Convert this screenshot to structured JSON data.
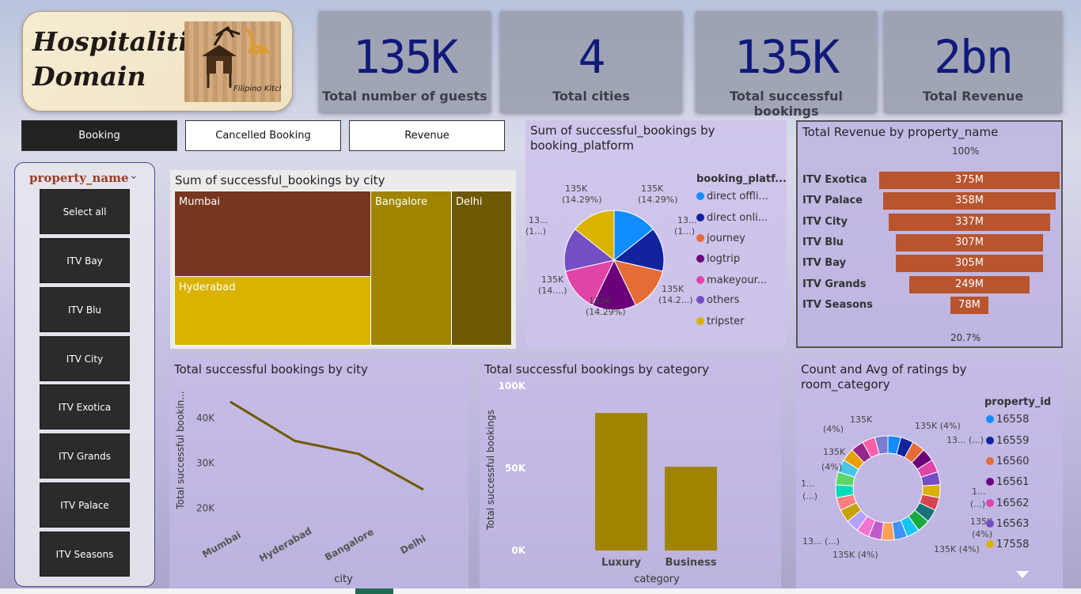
{
  "header": {
    "title_line1": "Hospitaliti",
    "title_line2": "Domain",
    "logo_text": "Filipino Kitchen"
  },
  "kpis": [
    {
      "value": "135K",
      "label": "Total number of guests"
    },
    {
      "value": "4",
      "label": "Total cities"
    },
    {
      "value": "135K",
      "label": "Total successful bookings"
    },
    {
      "value": "2bn",
      "label": "Total Revenue"
    }
  ],
  "nav": {
    "booking": "Booking",
    "cancelled": "Cancelled Booking",
    "revenue": "Revenue",
    "active": "Booking"
  },
  "slicer": {
    "title": "property_name",
    "chevron": "chevron-down-icon",
    "items": [
      "Select all",
      "ITV Bay",
      "ITV Blu",
      "ITV City",
      "ITV Exotica",
      "ITV Grands",
      "ITV Palace",
      "ITV Seasons"
    ]
  },
  "treemap": {
    "title": "Sum of successful_bookings by city",
    "cells": [
      {
        "label": "Mumbai",
        "color": "#76361f"
      },
      {
        "label": "Hyderabad",
        "color": "#d9b300"
      },
      {
        "label": "Bangalore",
        "color": "#a08400"
      },
      {
        "label": "Delhi",
        "color": "#6e5900"
      }
    ]
  },
  "pie": {
    "title": "Sum of successful_bookings by booking_platform",
    "legend_title": "booking_platf...",
    "legend": [
      {
        "name": "direct offli...",
        "color": "#118dff"
      },
      {
        "name": "direct onli...",
        "color": "#12239e"
      },
      {
        "name": "journey",
        "color": "#e66c37"
      },
      {
        "name": "logtrip",
        "color": "#6b007b"
      },
      {
        "name": "makeyour...",
        "color": "#e044a7"
      },
      {
        "name": "others",
        "color": "#744ec2"
      },
      {
        "name": "tripster",
        "color": "#d9b300"
      }
    ],
    "data_labels": [
      {
        "line1": "135K",
        "line2": "(14.29%)"
      },
      {
        "line1": "13...",
        "line2": "(1...)"
      },
      {
        "line1": "135K",
        "line2": "(14.2...)"
      },
      {
        "line1": "135K",
        "line2": "(14.29%)"
      },
      {
        "line1": "135K",
        "line2": "(14....)"
      },
      {
        "line1": "13...",
        "line2": "(1...)"
      },
      {
        "line1": "135K",
        "line2": "(14.29%)"
      }
    ]
  },
  "funnel": {
    "title": "Total Revenue by property_name",
    "top_pct": "100%",
    "bottom_pct": "20.7%",
    "rows": [
      {
        "name": "ITV Exotica",
        "label": "375M"
      },
      {
        "name": "ITV Palace",
        "label": "358M"
      },
      {
        "name": "ITV City",
        "label": "337M"
      },
      {
        "name": "ITV Blu",
        "label": "307M"
      },
      {
        "name": "ITV Bay",
        "label": "305M"
      },
      {
        "name": "ITV Grands",
        "label": "249M"
      },
      {
        "name": "ITV Seasons",
        "label": "78M"
      }
    ]
  },
  "line_chart": {
    "title": "Total successful bookings by city",
    "ylabel": "Total successful bookin...",
    "xlabel": "city",
    "y_ticks": [
      "40K",
      "30K",
      "20K"
    ]
  },
  "bar_chart": {
    "title": "Total successful bookings by category",
    "ylabel": "Total successful bookings",
    "xlabel": "category",
    "y_ticks": [
      "100K",
      "50K",
      "0K"
    ]
  },
  "donut": {
    "title_line1": "Count and Avg of ratings by",
    "title_line2": "room_category",
    "legend_title": "property_id",
    "legend": [
      {
        "name": "16558",
        "color": "#118dff"
      },
      {
        "name": "16559",
        "color": "#12239e"
      },
      {
        "name": "16560",
        "color": "#e66c37"
      },
      {
        "name": "16561",
        "color": "#6b007b"
      },
      {
        "name": "16562",
        "color": "#e044a7"
      },
      {
        "name": "16563",
        "color": "#744ec2"
      },
      {
        "name": "17558",
        "color": "#d9b300"
      }
    ],
    "data_labels": [
      "135K",
      "(4%)",
      "135K (4%)",
      "13... (...)",
      "135K",
      "(4%)",
      "1...",
      "(...)",
      "1...",
      "(...)",
      "135K",
      "(4%)",
      "13... (...)",
      "135K (4%)",
      "135K (4%)",
      "scroll-down-icon"
    ]
  },
  "chart_data": [
    {
      "type": "bar",
      "title": "Sum of successful_bookings by city",
      "categories": [
        "Mumbai",
        "Hyderabad",
        "Bangalore",
        "Delhi"
      ],
      "values": [
        43455,
        34888,
        32016,
        24231
      ]
    },
    {
      "type": "pie",
      "title": "Sum of successful_bookings by booking_platform",
      "categories": [
        "direct offli...",
        "direct onli...",
        "journey",
        "logtrip",
        "makeyour...",
        "others",
        "tripster"
      ],
      "values": [
        14.29,
        14.29,
        14.29,
        14.29,
        14.29,
        14.29,
        14.29
      ]
    },
    {
      "type": "bar",
      "title": "Total Revenue by property_name",
      "categories": [
        "ITV Exotica",
        "ITV Palace",
        "ITV City",
        "ITV Blu",
        "ITV Bay",
        "ITV Grands",
        "ITV Seasons"
      ],
      "values": [
        375,
        358,
        337,
        307,
        305,
        249,
        78
      ]
    },
    {
      "type": "line",
      "title": "Total successful bookings by city",
      "xlabel": "city",
      "ylabel": "Total successful bookin...",
      "categories": [
        "Mumbai",
        "Hyderabad",
        "Bangalore",
        "Delhi"
      ],
      "values": [
        43455,
        34888,
        32016,
        24231
      ],
      "ylim": [
        18000,
        46000
      ]
    },
    {
      "type": "bar",
      "title": "Total successful bookings by category",
      "xlabel": "category",
      "ylabel": "Total successful bookings",
      "categories": [
        "Luxury",
        "Business"
      ],
      "values": [
        83600,
        50900
      ],
      "ylim": [
        0,
        100000
      ]
    },
    {
      "type": "pie",
      "title": "Count and Avg of ratings by room_category",
      "categories": [
        "16558",
        "16559",
        "16560",
        "16561",
        "16562",
        "16563",
        "17558"
      ],
      "values": [
        4,
        4,
        4,
        4,
        4,
        4,
        4
      ]
    }
  ]
}
